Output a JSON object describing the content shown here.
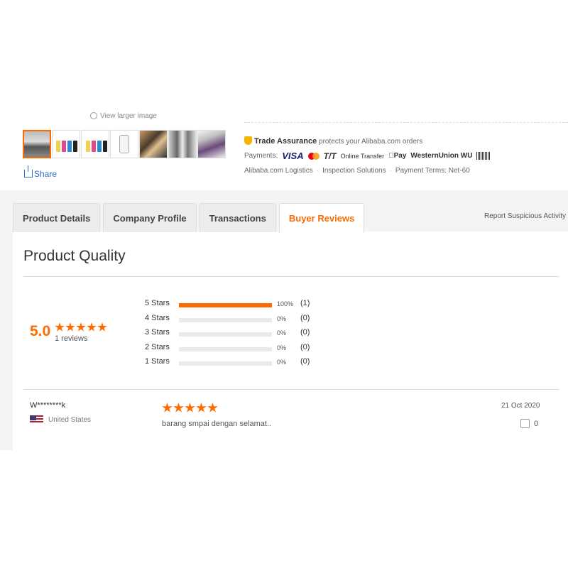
{
  "gallery": {
    "view_larger": "View larger image",
    "share": "Share"
  },
  "trade": {
    "title": "Trade Assurance",
    "subtitle": "protects your Alibaba.com orders",
    "payments_label": "Payments:",
    "methods": [
      "VISA",
      "T/T",
      "Online Transfer",
      "Pay",
      "WesternUnion WU"
    ],
    "logistics": "Alibaba.com Logistics",
    "inspection": "Inspection Solutions",
    "payment_terms": "Payment Terms: Net-60"
  },
  "tabs": [
    "Product Details",
    "Company Profile",
    "Transactions",
    "Buyer Reviews"
  ],
  "active_tab": "Buyer Reviews",
  "report_link": "Report Suspicious Activity",
  "section_title": "Product Quality",
  "rating": {
    "score": "5.0",
    "stars": 5,
    "reviews": "1 reviews",
    "distribution": [
      {
        "label": "5 Stars",
        "fraction": 1.0,
        "pct": "100%",
        "count": "(1)"
      },
      {
        "label": "4 Stars",
        "fraction": 0,
        "pct": "0%",
        "count": "(0)"
      },
      {
        "label": "3 Stars",
        "fraction": 0,
        "pct": "0%",
        "count": "(0)"
      },
      {
        "label": "2 Stars",
        "fraction": 0,
        "pct": "0%",
        "count": "(0)"
      },
      {
        "label": "1 Stars",
        "fraction": 0,
        "pct": "0%",
        "count": "(0)"
      }
    ]
  },
  "review": {
    "user": "W********k",
    "country": "United States",
    "stars": 5,
    "text": "barang smpai dengan selamat..",
    "date": "21 Oct 2020",
    "likes": "0"
  },
  "colors": {
    "accent": "#ff6a00",
    "link": "#2b6cc4"
  }
}
